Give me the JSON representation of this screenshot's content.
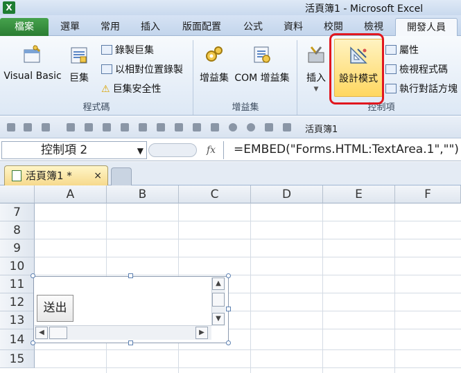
{
  "window": {
    "title": "活頁簿1 - Microsoft Excel",
    "app_icon": "X"
  },
  "tabs": [
    "檔案",
    "選單",
    "常用",
    "插入",
    "版面配置",
    "公式",
    "資料",
    "校閱",
    "檢視",
    "開發人員"
  ],
  "active_tab": "開發人員",
  "ribbon": {
    "code_group": {
      "label": "程式碼",
      "visual_basic": "Visual Basic",
      "macros": "巨集",
      "record_macro": "錄製巨集",
      "relative_ref": "以相對位置錄製",
      "macro_security": "巨集安全性"
    },
    "addins_group": {
      "label": "增益集",
      "addins": "增益集",
      "com_addins": "COM 增益集"
    },
    "controls_group": {
      "label": "控制項",
      "insert": "插入",
      "design_mode": "設計模式",
      "properties": "屬性",
      "view_code": "檢視程式碼",
      "run_dialog": "執行對話方塊"
    }
  },
  "toolbar": {
    "name_label": "活頁簿1"
  },
  "formula_bar": {
    "name_box": "控制項 2",
    "fx": "fx",
    "formula": "=EMBED(\"Forms.HTML:TextArea.1\",\"\")"
  },
  "workbook_tab": {
    "name": "活頁簿1 *",
    "close": "×"
  },
  "sheet": {
    "columns": [
      "A",
      "B",
      "C",
      "D",
      "E",
      "F"
    ],
    "rows": [
      "7",
      "8",
      "9",
      "10",
      "11",
      "12",
      "13",
      "14",
      "15"
    ]
  },
  "controls": {
    "submit_button": "送出"
  },
  "colors": {
    "file_tab": "#2a7d33",
    "design_highlight": "#ffd760",
    "callout": "#e1171f"
  }
}
